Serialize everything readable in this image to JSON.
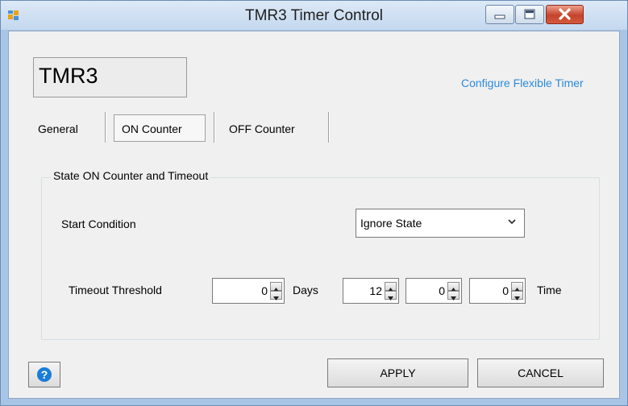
{
  "window": {
    "title": "TMR3 Timer Control"
  },
  "header": {
    "tag_name": "TMR3",
    "config_link": "Configure Flexible Timer"
  },
  "tabs": [
    {
      "label": "General",
      "selected": false
    },
    {
      "label": "ON Counter",
      "selected": true
    },
    {
      "label": "OFF Counter",
      "selected": false
    }
  ],
  "group": {
    "title": "State ON Counter and Timeout",
    "start_condition_label": "Start Condition",
    "start_condition_value": "Ignore State",
    "timeout_label": "Timeout Threshold",
    "days_value": "0",
    "days_label": "Days",
    "hours_value": "12",
    "minutes_value": "0",
    "seconds_value": "0",
    "time_label": "Time"
  },
  "buttons": {
    "apply": "APPLY",
    "cancel": "CANCEL"
  },
  "icons": {
    "app": "app-icon",
    "help": "help-icon",
    "minimize": "minimize-icon",
    "maximize": "maximize-icon",
    "close": "close-icon",
    "dropdown": "chevron-down-icon"
  },
  "colors": {
    "link": "#2b8ad8",
    "help_icon": "#1a7dd6",
    "close_button": "#c5432b"
  }
}
